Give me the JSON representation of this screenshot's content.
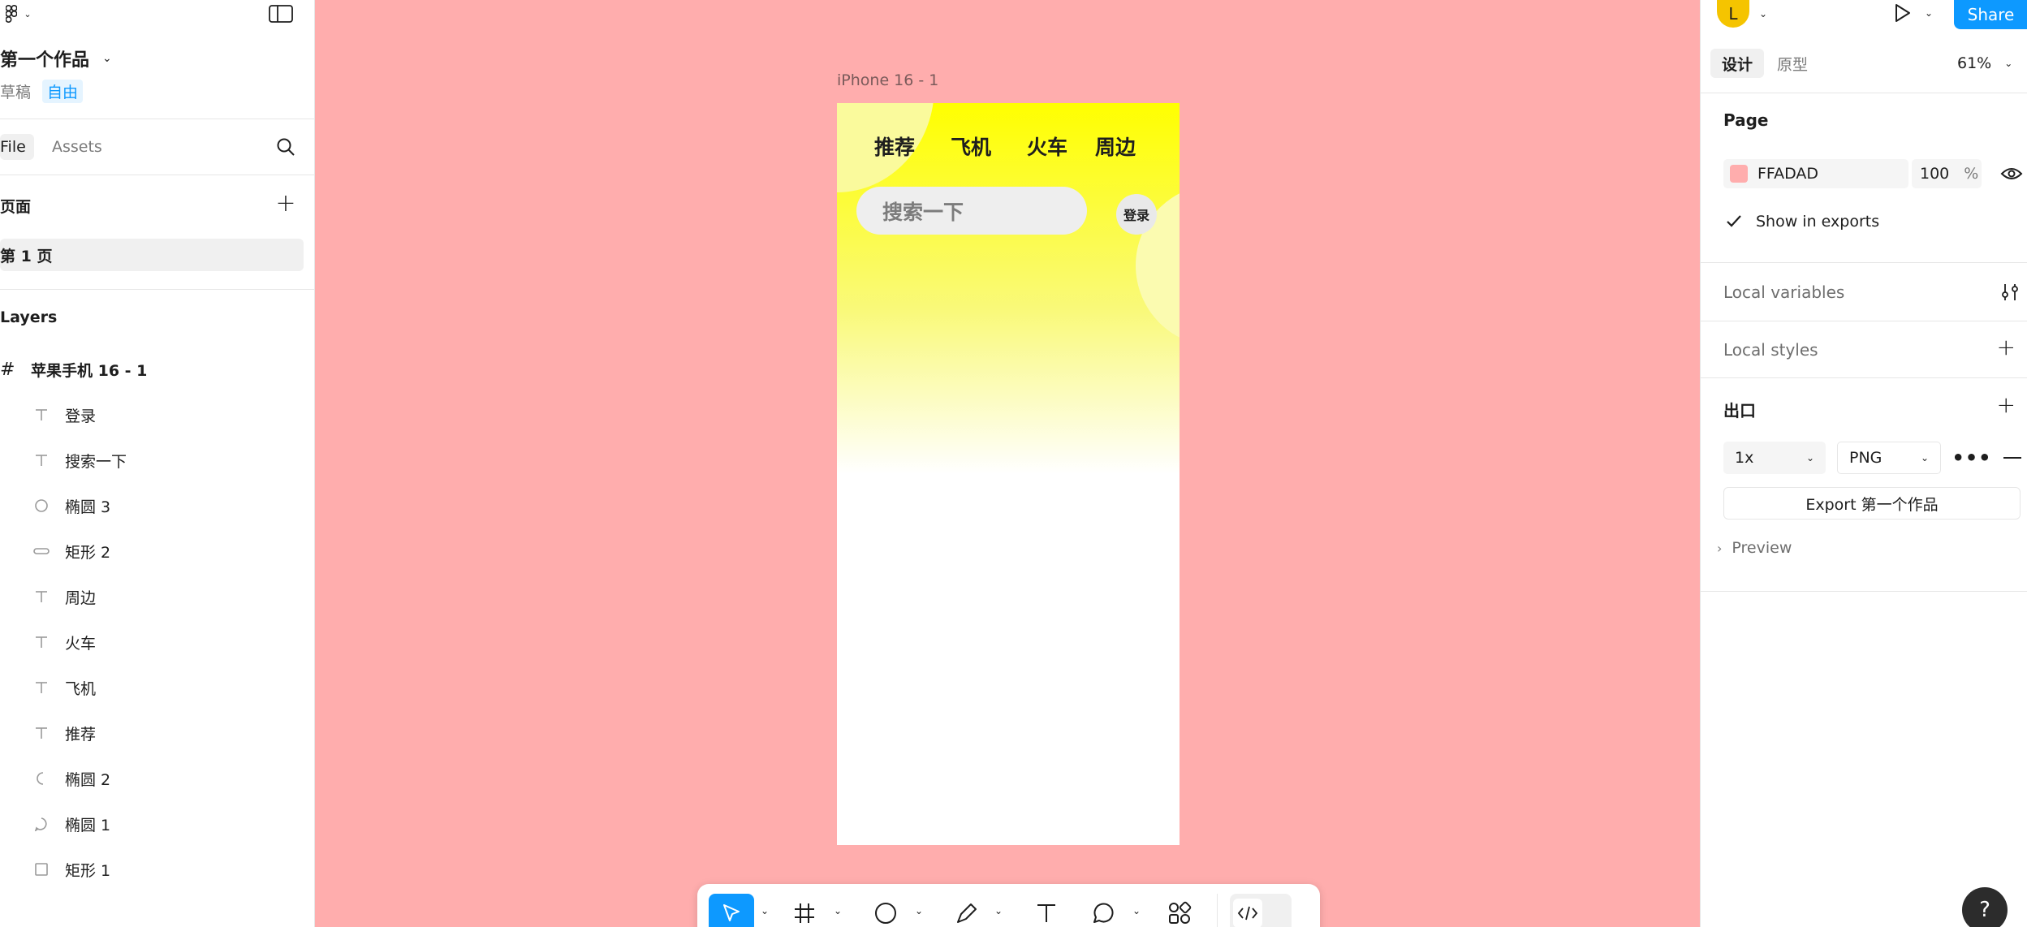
{
  "file": {
    "title": "第一个作品",
    "status": "草稿",
    "plan_badge": "自由"
  },
  "left_tabs": {
    "file": "File",
    "assets": "Assets"
  },
  "pages": {
    "header": "页面",
    "items": [
      "第 1 页"
    ]
  },
  "layers": {
    "header": "Layers",
    "frame": "苹果手机 16 - 1",
    "items": [
      {
        "name": "登录",
        "icon": "text-icon"
      },
      {
        "name": "搜索一下",
        "icon": "text-icon"
      },
      {
        "name": "椭圆 3",
        "icon": "ellipse-icon"
      },
      {
        "name": "矩形 2",
        "icon": "rounded-rect-icon"
      },
      {
        "name": "周边",
        "icon": "text-icon"
      },
      {
        "name": "火车",
        "icon": "text-icon"
      },
      {
        "name": "飞机",
        "icon": "text-icon"
      },
      {
        "name": "推荐",
        "icon": "text-icon"
      },
      {
        "name": "椭圆 2",
        "icon": "partial-ellipse-icon"
      },
      {
        "name": "椭圆 1",
        "icon": "blob-icon"
      },
      {
        "name": "矩形 1",
        "icon": "rect-icon"
      }
    ]
  },
  "canvas": {
    "background": "#FFADAD",
    "frame_label": "iPhone 16 - 1",
    "phone": {
      "tabs": [
        "推荐",
        "飞机",
        "火车",
        "周边"
      ],
      "search_placeholder": "搜索一下",
      "login_label": "登录",
      "gradient_top": "#FFFF00"
    }
  },
  "toolbar": {
    "tools": [
      "move-tool",
      "frame-tool",
      "shape-tool",
      "pen-tool",
      "text-tool",
      "comment-tool",
      "actions-tool",
      "dev-mode-toggle"
    ],
    "active": "move-tool",
    "accent": "#0d99ff"
  },
  "right_panel": {
    "avatar_letter": "L",
    "share_label": "Share",
    "tabs": [
      "设计",
      "原型"
    ],
    "active_tab": "设计",
    "zoom": "61%",
    "page_section": "Page",
    "page_color_hex": "FFADAD",
    "page_color": "#FFADAD",
    "page_opacity": "100",
    "page_opacity_unit": "%",
    "show_in_exports": "Show in exports",
    "local_variables": "Local variables",
    "local_styles": "Local styles",
    "export_section": "出口",
    "export_scale": "1x",
    "export_format": "PNG",
    "export_button": "Export 第一个作品",
    "preview_label": "Preview"
  },
  "help_label": "?"
}
